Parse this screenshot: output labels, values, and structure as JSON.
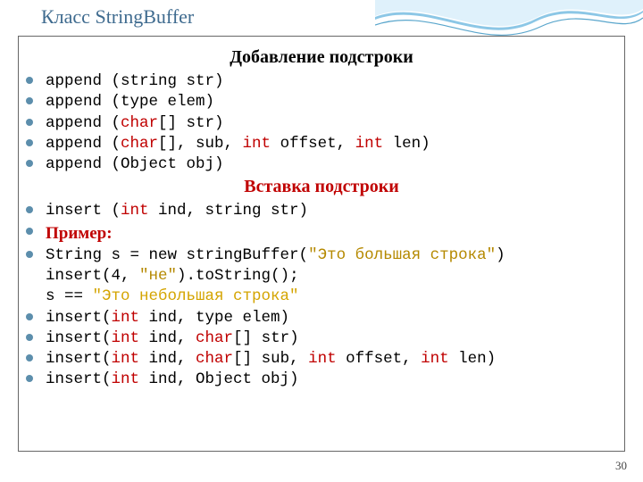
{
  "title": {
    "rus": "Класс",
    "en": "StringBuffer"
  },
  "page": "30",
  "sections": {
    "append": {
      "heading": "Добавление подстроки",
      "items": [
        {
          "a": "append (string str)"
        },
        {
          "a": "append (type elem)"
        },
        {
          "a": "append (",
          "b": "char",
          "c": "[] str)"
        },
        {
          "a": "append (",
          "b": "char",
          "c": "[], sub, ",
          "d": "int",
          "e": " offset, ",
          "f": "int",
          "g": " len)"
        },
        {
          "a": "append (Object obj)"
        }
      ]
    },
    "insert": {
      "heading": "Вставка подстроки",
      "items": [
        {
          "a": "insert (",
          "b": "int",
          "c": " ind, string str)"
        },
        {
          "a": "Пример:"
        },
        {
          "a": "String s = new stringBuffer(",
          "b": "\"Это большая строка\"",
          "c": ")"
        }
      ],
      "cont1": {
        "a": "insert(4, ",
        "b": "\"не\"",
        "c": ").toString();"
      },
      "cont2": {
        "a": "s == ",
        "b": "\"Это небольшая строка\""
      },
      "items2": [
        {
          "a": "insert(",
          "b": "int",
          "c": " ind, type elem)"
        },
        {
          "a": "insert(",
          "b": "int",
          "c": " ind, ",
          "d": "char",
          "e": "[] str)"
        },
        {
          "a": "insert(",
          "b": "int",
          "c": " ind, ",
          "d": "char",
          "e": "[] sub, ",
          "f": "int",
          "g": " offset, ",
          "h": "int",
          "i": " len)"
        },
        {
          "a": "insert(",
          "b": "int",
          "c": " ind, Object obj)"
        }
      ]
    }
  }
}
